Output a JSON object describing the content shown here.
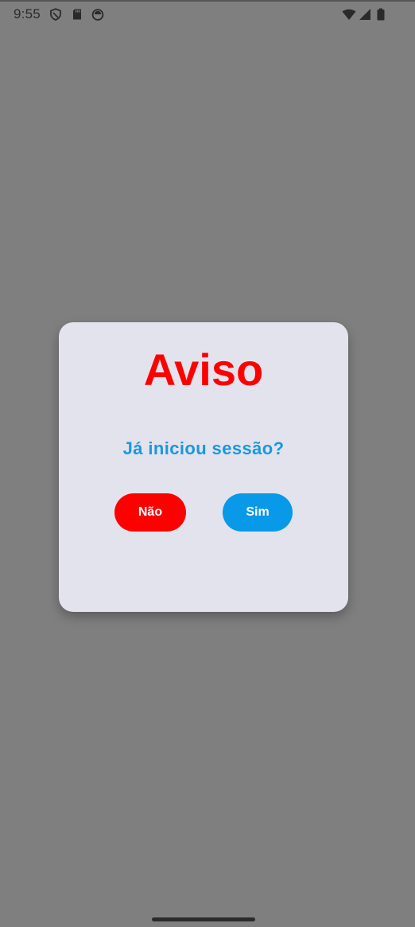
{
  "status_bar": {
    "time": "9:55",
    "left_icons": [
      "shield-icon",
      "sd-card-icon",
      "app-notification-icon"
    ],
    "right_icons": [
      "wifi-icon",
      "signal-icon",
      "battery-icon"
    ]
  },
  "dialog": {
    "title": "Aviso",
    "message": "Já iniciou sessão?",
    "no_label": "Não",
    "yes_label": "Sim"
  },
  "colors": {
    "scrim": "#7f7f7f",
    "dialog_bg": "#e3e3ee",
    "title": "#ff0000",
    "message": "#1a98dd",
    "no_button": "#ff0000",
    "yes_button": "#0899e8"
  }
}
